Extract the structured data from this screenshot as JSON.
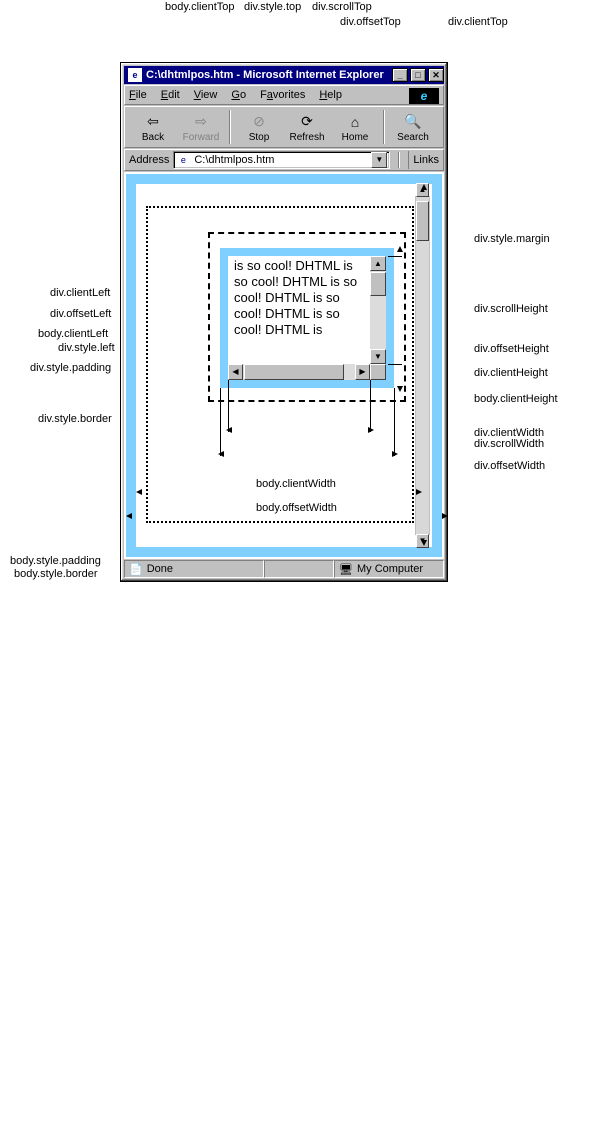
{
  "window": {
    "title": "C:\\dhtmlpos.htm - Microsoft Internet Explorer",
    "controls": {
      "min": "_",
      "max": "□",
      "close": "✕"
    }
  },
  "menubar": {
    "file": "File",
    "edit": "Edit",
    "view": "View",
    "go": "Go",
    "favorites": "Favorites",
    "help": "Help"
  },
  "toolbar": {
    "back": "Back",
    "forward": "Forward",
    "stop": "Stop",
    "refresh": "Refresh",
    "home": "Home",
    "search": "Search"
  },
  "addressbar": {
    "label": "Address",
    "value": "C:\\dhtmlpos.htm",
    "links": "Links"
  },
  "statusbar": {
    "done": "Done",
    "zone": "My Computer"
  },
  "div_text": "is so cool! DHTML is so cool! DHTML is so cool! DHTML is so cool! DHTML is so cool! DHTML is",
  "labels": {
    "body_clientTop": "body.clientTop",
    "div_style_top": "div.style.top",
    "div_scrollTop": "div.scrollTop",
    "div_offsetTop": "div.offsetTop",
    "div_clientTop": "div.clientTop",
    "div_clientLeft": "div.clientLeft",
    "div_offsetLeft": "div.offsetLeft",
    "body_clientLeft": "body.clientLeft",
    "div_style_left": "div.style.left",
    "div_style_padding": "div.style.padding",
    "div_style_border": "div.style.border",
    "body_style_padding": "body.style.padding",
    "body_style_border": "body.style.border",
    "div_style_margin": "div.style.margin",
    "div_scrollHeight": "div.scrollHeight",
    "div_offsetHeight": "div.offsetHeight",
    "div_clientHeight": "div.clientHeight",
    "body_clientHeight": "body.clientHeight",
    "div_clientWidth": "div.clientWidth",
    "div_scrollWidth": "div.scrollWidth",
    "div_offsetWidth": "div.offsetWidth",
    "body_clientWidth": "body.clientWidth",
    "body_offsetWidth": "body.offsetWidth"
  }
}
